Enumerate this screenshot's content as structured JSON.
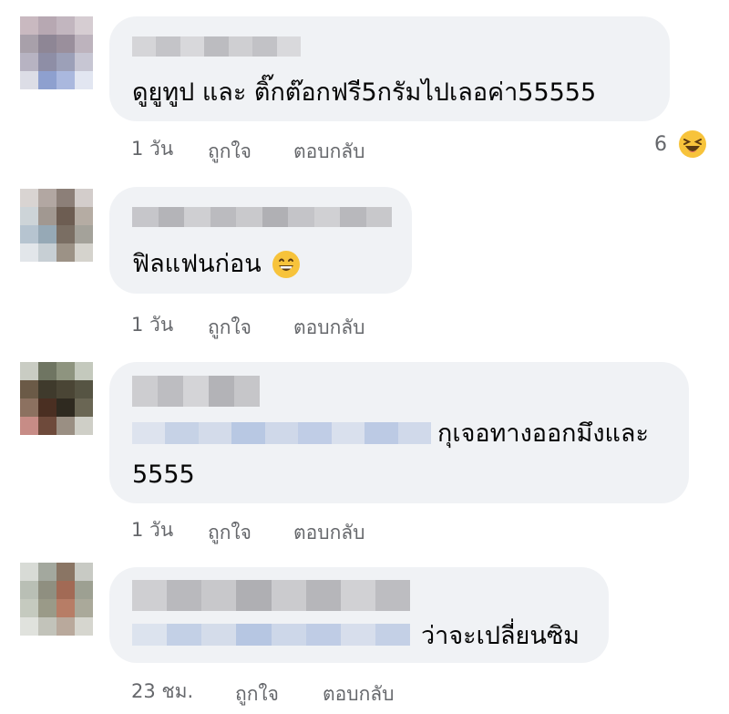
{
  "comments": [
    {
      "text_lines": [
        "ดูยูทูป และ ติ๊กต๊อกฟรี5กรัมไปเลอค่า55555"
      ],
      "time": "1 วัน",
      "like_label": "ถูกใจ",
      "reply_label": "ตอบกลับ",
      "reaction_count": "6",
      "reaction_icon": "haha-emoji-icon"
    },
    {
      "text_lines": [
        "ฟิลแฟนก่อน"
      ],
      "inline_icon": "grinning-face-icon",
      "time": "1 วัน",
      "like_label": "ถูกใจ",
      "reply_label": "ตอบกลับ"
    },
    {
      "text_lines": [
        "กุเจอทางออกมึงและ",
        "5555"
      ],
      "time": "1 วัน",
      "like_label": "ถูกใจ",
      "reply_label": "ตอบกลับ"
    },
    {
      "text_lines": [
        "ว่าจะเปลี่ยนซิม"
      ],
      "time": "23 ชม.",
      "like_label": "ถูกใจ",
      "reply_label": "ตอบกลับ"
    }
  ]
}
